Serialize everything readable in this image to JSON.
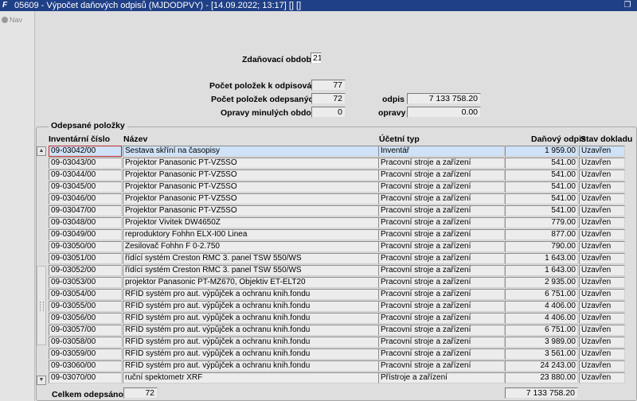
{
  "window": {
    "title": "05609 - Výpočet daňových odpisů (MJDODPVY) - [14.09.2022; 13:17] [] []",
    "app_icon": "F"
  },
  "nav": {
    "label": "Nav"
  },
  "period": {
    "label": "Zdaňovací období",
    "value": "21"
  },
  "summary": {
    "items_to_depreciate_label": "Počet položek k odpisování",
    "items_to_depreciate_value": "77",
    "items_depreciated_label": "Počet položek odepsaných",
    "items_depreciated_value": "72",
    "corrections_prev_label": "Opravy minulých období",
    "corrections_prev_value": "0",
    "odpis_label": "odpis",
    "odpis_value": "7 133 758.20",
    "opravy_label": "opravy",
    "opravy_value": "0.00"
  },
  "table": {
    "group_title": "Odepsané položky",
    "columns": {
      "inventory": "Inventární číslo",
      "name": "Název",
      "type": "Účetní typ",
      "amount": "Daňový odpis",
      "status": "Stav dokladu"
    },
    "rows": [
      {
        "inv": "09-03042/00",
        "name": "Sestava skříní na časopisy",
        "type": "Inventář",
        "amount": "1 959.00",
        "status": "Uzavřen"
      },
      {
        "inv": "09-03043/00",
        "name": "Projektor Panasonic PT-VZ5SO",
        "type": "Pracovní stroje a zařízení",
        "amount": "541.00",
        "status": "Uzavřen"
      },
      {
        "inv": "09-03044/00",
        "name": "Projektor Panasonic PT-VZ5SO",
        "type": "Pracovní stroje a zařízení",
        "amount": "541.00",
        "status": "Uzavřen"
      },
      {
        "inv": "09-03045/00",
        "name": "Projektor Panasonic PT-VZ5SO",
        "type": "Pracovní stroje a zařízení",
        "amount": "541.00",
        "status": "Uzavřen"
      },
      {
        "inv": "09-03046/00",
        "name": "Projektor Panasonic PT-VZ5SO",
        "type": "Pracovní stroje a zařízení",
        "amount": "541.00",
        "status": "Uzavřen"
      },
      {
        "inv": "09-03047/00",
        "name": "Projektor Panasonic PT-VZ5SO",
        "type": "Pracovní stroje a zařízení",
        "amount": "541.00",
        "status": "Uzavřen"
      },
      {
        "inv": "09-03048/00",
        "name": "Projektor Vivitek DW4650Z",
        "type": "Pracovní stroje a zařízení",
        "amount": "779.00",
        "status": "Uzavřen"
      },
      {
        "inv": "09-03049/00",
        "name": "reproduktory Fohhn ELX-I00 Linea",
        "type": "Pracovní stroje a zařízení",
        "amount": "877.00",
        "status": "Uzavřen"
      },
      {
        "inv": "09-03050/00",
        "name": "Zesilovač Fohhn F 0-2.750",
        "type": "Pracovní stroje a zařízení",
        "amount": "790.00",
        "status": "Uzavřen"
      },
      {
        "inv": "09-03051/00",
        "name": "řídící systém Creston RMC 3. panel TSW 550/WS",
        "type": "Pracovní stroje a zařízení",
        "amount": "1 643.00",
        "status": "Uzavřen"
      },
      {
        "inv": "09-03052/00",
        "name": "řídící systém Creston RMC 3. panel TSW 550/WS",
        "type": "Pracovní stroje a zařízení",
        "amount": "1 643.00",
        "status": "Uzavřen"
      },
      {
        "inv": "09-03053/00",
        "name": "projektor Panasonic PT-MZ670, Objektiv ET-ELT20",
        "type": "Pracovní stroje a zařízení",
        "amount": "2 935.00",
        "status": "Uzavřen"
      },
      {
        "inv": "09-03054/00",
        "name": "RFID systém pro aut. výpůjček a ochranu knih.fondu",
        "type": "Pracovní stroje a zařízení",
        "amount": "6 751.00",
        "status": "Uzavřen"
      },
      {
        "inv": "09-03055/00",
        "name": "RFID systém pro aut. výpůjček a ochranu knih.fondu",
        "type": "Pracovní stroje a zařízení",
        "amount": "4 406.00",
        "status": "Uzavřen"
      },
      {
        "inv": "09-03056/00",
        "name": "RFID systém pro aut. výpůjček a ochranu knih.fondu",
        "type": "Pracovní stroje a zařízení",
        "amount": "4 406.00",
        "status": "Uzavřen"
      },
      {
        "inv": "09-03057/00",
        "name": "RFID systém pro aut. výpůjček a ochranu knih.fondu",
        "type": "Pracovní stroje a zařízení",
        "amount": "6 751.00",
        "status": "Uzavřen"
      },
      {
        "inv": "09-03058/00",
        "name": "RFID systém pro aut. výpůjček a ochranu knih.fondu",
        "type": "Pracovní stroje a zařízení",
        "amount": "3 989.00",
        "status": "Uzavřen"
      },
      {
        "inv": "09-03059/00",
        "name": "RFID systém pro aut. výpůjček a ochranu knih.fondu",
        "type": "Pracovní stroje a zařízení",
        "amount": "3 561.00",
        "status": "Uzavřen"
      },
      {
        "inv": "09-03060/00",
        "name": "RFID systém pro aut. výpůjček a ochranu knih.fondu",
        "type": "Pracovní stroje a zařízení",
        "amount": "24 243.00",
        "status": "Uzavřen"
      },
      {
        "inv": "09-03070/00",
        "name": "ruční spektometr XRF",
        "type": "Přístroje a zařízení",
        "amount": "23 880.00",
        "status": "Uzavřen"
      }
    ]
  },
  "footer": {
    "total_label": "Celkem odepsáno",
    "total_count": "72",
    "total_amount": "7 133 758.20"
  },
  "icons": {
    "app": "app-logo-icon",
    "restore": "window-restore-icon",
    "nav": "nav-icon",
    "scroll_up": "scroll-up-icon",
    "scroll_down": "scroll-down-icon"
  },
  "colors": {
    "titlebar": "#1f3f86",
    "selected_row": "#cfe2f7",
    "focus_border": "#c0282b"
  }
}
